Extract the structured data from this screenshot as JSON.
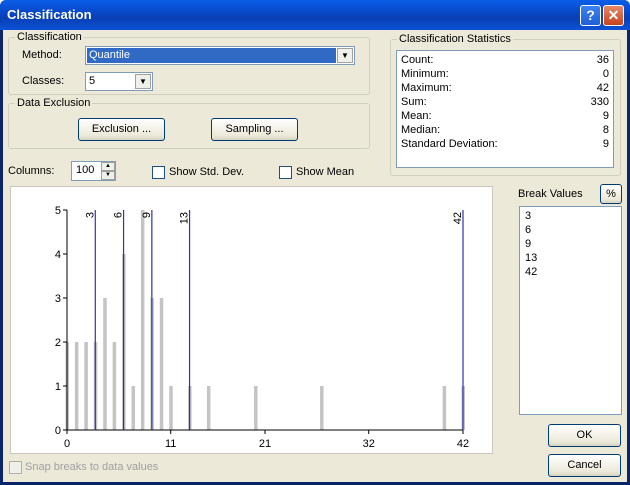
{
  "window": {
    "title": "Classification",
    "help_label": "?",
    "close_label": "✕"
  },
  "classification": {
    "group_title": "Classification",
    "method_label": "Method:",
    "method_value": "Quantile",
    "classes_label": "Classes:",
    "classes_value": "5"
  },
  "data_exclusion": {
    "group_title": "Data Exclusion",
    "exclusion_button": "Exclusion ...",
    "sampling_button": "Sampling ..."
  },
  "statistics": {
    "group_title": "Classification Statistics",
    "rows": [
      {
        "label": "Count:",
        "value": "36"
      },
      {
        "label": "Minimum:",
        "value": "0"
      },
      {
        "label": "Maximum:",
        "value": "42"
      },
      {
        "label": "Sum:",
        "value": "330"
      },
      {
        "label": "Mean:",
        "value": "9"
      },
      {
        "label": "Median:",
        "value": "8"
      },
      {
        "label": "Standard Deviation:",
        "value": "9"
      }
    ]
  },
  "columns": {
    "label": "Columns:",
    "value": "100"
  },
  "options": {
    "show_std_dev": "Show Std. Dev.",
    "show_mean": "Show Mean",
    "snap_breaks": "Snap breaks to data values"
  },
  "break_values": {
    "title": "Break Values",
    "percent_button": "%",
    "values": [
      "3",
      "6",
      "9",
      "13",
      "42"
    ]
  },
  "buttons": {
    "ok": "OK",
    "cancel": "Cancel"
  },
  "colors": {
    "bar": "#c4c4c4",
    "break_line": "#3030b0",
    "accent": "#316ac5"
  },
  "chart_data": {
    "type": "bar",
    "x_ticks": [
      0,
      11,
      21,
      32,
      42
    ],
    "y_ticks": [
      0,
      1,
      2,
      3,
      4,
      5
    ],
    "xlim": [
      0,
      42
    ],
    "ylim": [
      0,
      5
    ],
    "bars": [
      {
        "x": 0,
        "y": 2
      },
      {
        "x": 1,
        "y": 2
      },
      {
        "x": 2,
        "y": 2
      },
      {
        "x": 3,
        "y": 2
      },
      {
        "x": 4,
        "y": 3
      },
      {
        "x": 5,
        "y": 2
      },
      {
        "x": 6,
        "y": 4
      },
      {
        "x": 7,
        "y": 1
      },
      {
        "x": 8,
        "y": 5
      },
      {
        "x": 9,
        "y": 3
      },
      {
        "x": 10,
        "y": 3
      },
      {
        "x": 11,
        "y": 1
      },
      {
        "x": 13,
        "y": 1
      },
      {
        "x": 15,
        "y": 1
      },
      {
        "x": 20,
        "y": 1
      },
      {
        "x": 27,
        "y": 1
      },
      {
        "x": 40,
        "y": 1
      },
      {
        "x": 42,
        "y": 1
      }
    ],
    "breaks": [
      3,
      6,
      9,
      13,
      42
    ]
  }
}
